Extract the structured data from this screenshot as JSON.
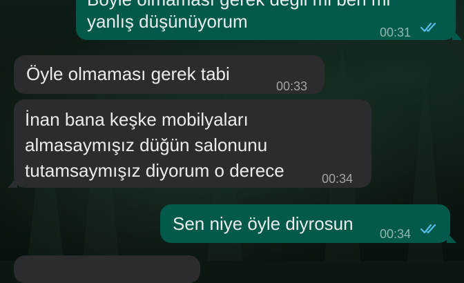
{
  "chat": {
    "messages": [
      {
        "direction": "out",
        "lines": [
          "Böyle olmaması gerek değil mi ben mi",
          "yanlış düşünüyorum"
        ],
        "time": "00:31",
        "read": true
      },
      {
        "direction": "in",
        "lines": [
          "Öyle olmaması gerek tabi"
        ],
        "time": "00:33"
      },
      {
        "direction": "in",
        "lines": [
          "İnan bana keşke mobilyaları",
          "almasaymışız düğün salonunu",
          "tutamsaymışız diyorum o derece"
        ],
        "time": "00:34"
      },
      {
        "direction": "out",
        "lines": [
          "Sen niye öyle diyrosun"
        ],
        "time": "00:34",
        "read": true
      }
    ]
  },
  "colors": {
    "incoming_bubble": "#2a2c2d",
    "outgoing_bubble": "#03594a",
    "read_ticks": "#53bdeb",
    "text": "#e9edef"
  },
  "icons": {
    "read_receipt": "double-check-icon"
  }
}
